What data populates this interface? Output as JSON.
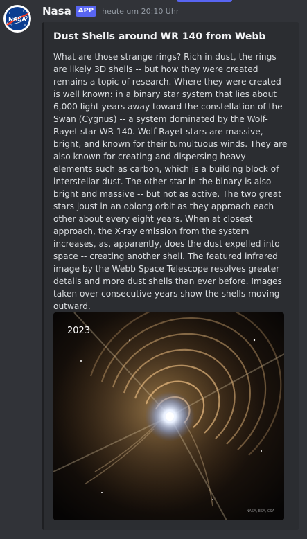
{
  "message": {
    "author": "Nasa",
    "badge": "APP",
    "timestamp": "heute um 20:10 Uhr"
  },
  "embed": {
    "title": "Dust Shells around WR 140 from Webb",
    "description": "What are those strange rings? Rich in dust, the rings are likely 3D shells -- but how they were created remains a topic of research. Where they were created is well known: in a binary star system that lies about 6,000 light years away toward the constellation of the Swan (Cygnus) -- a system dominated by the Wolf-Rayet star WR 140. Wolf-Rayet stars are massive, bright, and known for their tumultuous winds. They are also known for creating and dispersing heavy elements such as carbon, which is a building block of interstellar dust. The other star in the binary is also bright and massive -- but not as active. The two great stars joust in an oblong orbit as they approach each other about every eight years. When at closest approach, the X-ray emission from the system increases, as, apparently, does the dust expelled into space -- creating another shell. The featured infrared image by the Webb Space Telescope resolves greater details and more dust shells than ever before. Images taken over consecutive years show the shells moving outward.",
    "image": {
      "year_label": "2023",
      "credit": "NASA, ESA, CSA"
    }
  },
  "avatar": {
    "logo_text": "NASA"
  },
  "colors": {
    "background": "#313338",
    "embed_background": "#2b2d31",
    "badge": "#5865f2",
    "nasa_blue": "#0b3d91",
    "nasa_red": "#fc3d21"
  }
}
